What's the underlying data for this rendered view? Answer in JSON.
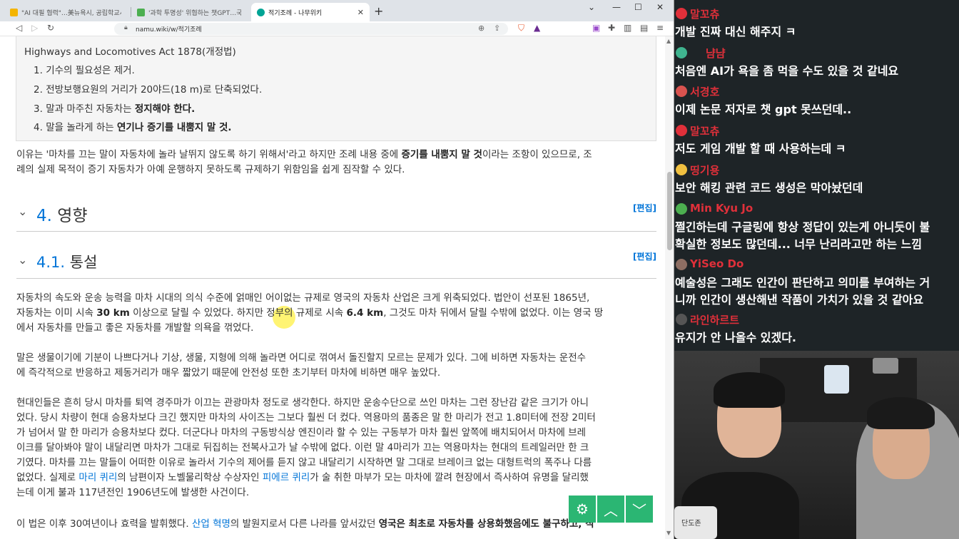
{
  "browser": {
    "tabs": [
      {
        "label": "\"AI 대필 협력\"…美뉴욕시, 공립학교서",
        "fav_color": "#f4b400"
      },
      {
        "label": "'과학 투명성' 위협하는 챗GPT…국제",
        "fav_color": "#4caf50"
      },
      {
        "label": "적기조례 - 나무위키",
        "fav_color": "#00a495"
      }
    ],
    "url": "namu.wiki/w/적기조례"
  },
  "article": {
    "quote": {
      "title": "Highways and Locomotives Act 1878(개정법)",
      "items": [
        {
          "n": "1.",
          "text": "기수의 필요성은 제거.",
          "bold": ""
        },
        {
          "n": "2.",
          "text": "전방보행요원의 거리가 20야드(18 m)로 단축되었다.",
          "bold": ""
        },
        {
          "n": "3.",
          "text": "말과 마주친 자동차는 ",
          "bold": "정지해야 한다."
        },
        {
          "n": "4.",
          "text": "말을 놀라게 하는 ",
          "bold": "연기나 증기를 내뿜지 말 것."
        }
      ]
    },
    "reason": {
      "l1a": "이유는 '마차를 끄는 말이 자동차에 놀라 날뛰지 않도록 하기 위해서'라고 하지만 조례 내용 중에 ",
      "l1b": "증기를 내뿜지 말 것",
      "l1c": "이라는 조항이 있으므로, 조",
      "l2": "례의 실제 목적이 증기 자동차가 아예 운행하지 못하도록 규제하기 위함임을 쉽게 짐작할 수 있다."
    },
    "sec4": {
      "num": "4.",
      "title": "영향",
      "edit": "[편집]"
    },
    "sec41": {
      "num": "4.1.",
      "title": "통설",
      "edit": "[편집]"
    },
    "p1": {
      "l1": "자동차의 속도와 운송 능력을 마차 시대의 의식 수준에 얽매인 어이없는 규제로 영국의 자동차 산업은 크게 위축되었다. 법안이 선포된 1865년,",
      "l2a": "자동차는 이미 시속 ",
      "l2b": "30 km",
      "l2c": " 이상으로 달릴 수 있었다. 하지만 정부의 규제로 시속 ",
      "l2d": "6.4 km",
      "l2e": ", 그것도 마차 뒤에서 달릴 수밖에 없었다. 이는 영국 땅",
      "l3": "에서 자동차를 만들고 좋은 자동차를 개발할 의욕을 꺾었다."
    },
    "p2": {
      "l1": "말은 생물이기에 기분이 나쁘다거나 기상, 생물, 지형에 의해 놀라면 어디로 꺾여서 돌진할지 모르는 문제가 있다. 그에 비하면 자동차는 운전수",
      "l2": "에 즉각적으로 반응하고 제동거리가 매우 짧았기 때문에 안전성 또한 초기부터 마차에 비하면 매우 높았다."
    },
    "p3": {
      "l1": "현대인들은 흔히 당시 마차를 퇴역 경주마가 이끄는 관광마차 정도로 생각한다. 하지만 운송수단으로 쓰인 마차는 그런 장난감 같은 크기가 아니",
      "l2": "었다. 당시 차량이 현대 승용차보다 크긴 했지만 마차의 사이즈는 그보다 훨씬 더 컸다. 역용마의 품종은 말 한 마리가 전고 1.8미터에 전장 2미터",
      "l3": "가 넘어서 말 한 마리가 승용차보다 컸다. 더군다나 마차의 구동방식상 엔진이라 할 수 있는 구동부가 마차 훨씬 앞쪽에 배치되어서 마차에 브레",
      "l4": "이크를 달아봐야 말이 내달리면 마차가 그대로 뒤집히는 전복사고가 날 수밖에 없다. 이런 말 4마리가 끄는 역용마차는 현대의 트레일러만 한 크",
      "l5": "기였다. 마차를 끄는 말들이 어떠한 이유로 놀라서 기수의 제어를 듣지 않고 내달리기 시작하면 말 그대로 브레이크 없는 대형트럭의 폭주나 다름",
      "l6a": "없었다. 실제로 ",
      "l6b": "마리 퀴리",
      "l6c": "의 남편이자 노벨물리학상 수상자인 ",
      "l6d": "피에르 퀴리",
      "l6e": "가 술 취한 마부가 모는 마차에 깔려 현장에서 즉사하여 유명을 달리했",
      "l7": "는데 이게 불과 117년전인 1906년도에 발생한 사건이다."
    },
    "p4": {
      "a": "이 법은 이후 30여년이나 효력을 발휘했다. ",
      "b": "산업 혁명",
      "c": "의 발원지로서 다른 나라를 앞서갔던 ",
      "d": "영국은 최초로 자동차를 상용화했음에도 불구하고, 적"
    }
  },
  "chat": [
    {
      "user": "말꼬츄",
      "text": "개발 진짜 대신 해주지 ㅋ",
      "avatar": "#e0303a"
    },
    {
      "user": "냠냠",
      "text": "처음엔 AI가 욕을 좀 먹을 수도 있을 것 같네요",
      "avatar": "#3fb48f"
    },
    {
      "user": "서경호",
      "text": "이제 논문 저자로 챗 gpt 못쓰던데..",
      "avatar": "#d9534f"
    },
    {
      "user": "말꼬츄",
      "text": "저도 게임 개발 할 때 사용하는데 ㅋ",
      "avatar": "#e0303a"
    },
    {
      "user": "띵기용",
      "text": "보안 해킹 관련 코드 생성은 막아놨던데",
      "avatar": "#f0c040"
    },
    {
      "user": "Min Kyu Jo",
      "text": "쩔긴하는데 구글링에 항상 정답이 있는게 아니듯이 불",
      "text2": "확실한 정보도 많던데... 너무 난리라고만 하는 느낌",
      "avatar": "#4caf50"
    },
    {
      "user": "YiSeo Do",
      "text": "예술성은 그래도 인간이 판단하고 의미를 부여하는 거",
      "text2": "니까 인간이 생산해낸 작품이 가치가 있을 것 같아요",
      "avatar": "#8d6e63"
    },
    {
      "user": "라인하르트",
      "text": "유지가 안 나올수 있겠다.",
      "avatar": "#555555"
    }
  ],
  "cam": {
    "mug_text": "단도존"
  }
}
